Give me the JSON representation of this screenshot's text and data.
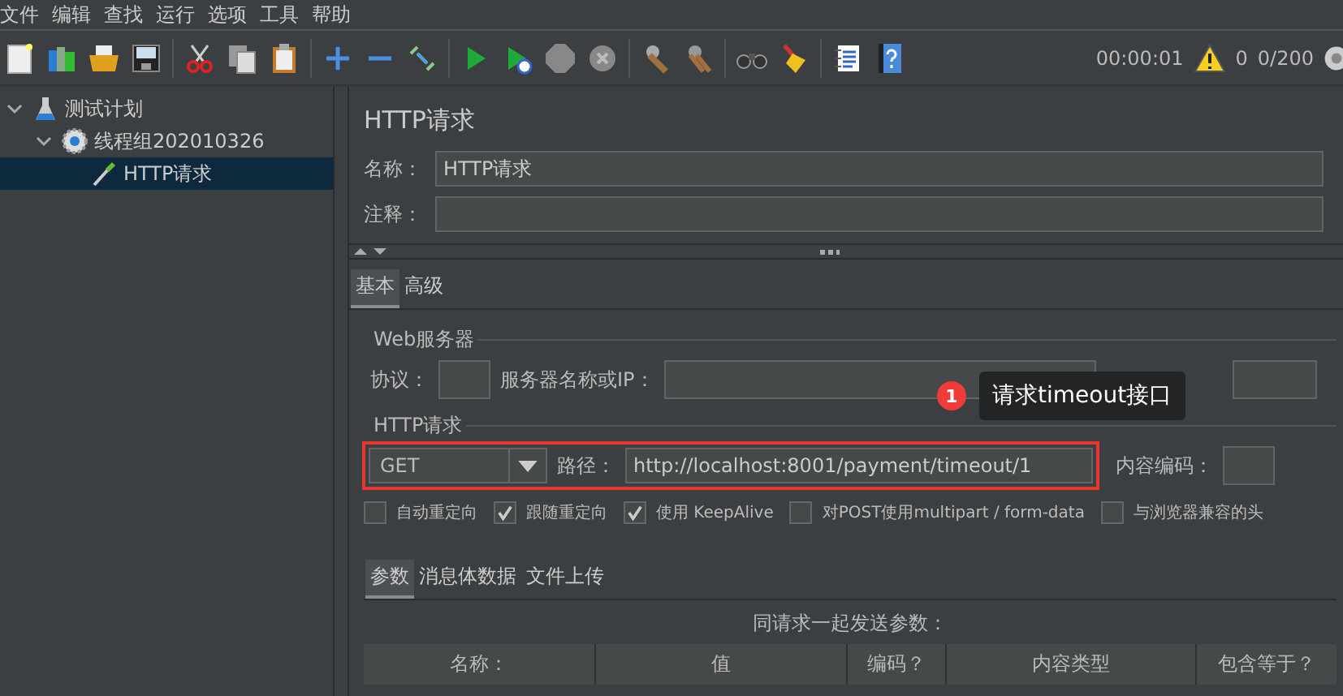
{
  "menu": [
    "文件",
    "编辑",
    "查找",
    "运行",
    "选项",
    "工具",
    "帮助"
  ],
  "toolbar": {
    "timer": "00:00:01",
    "warnings": "0",
    "threads": "0/200"
  },
  "tree": [
    {
      "label": "测试计划",
      "expanded": true,
      "selected": false,
      "children": [
        {
          "label": "线程组202010326",
          "expanded": true,
          "selected": false,
          "children": [
            {
              "label": "HTTP请求",
              "selected": true
            }
          ]
        }
      ]
    }
  ],
  "panel": {
    "title": "HTTP请求",
    "name_label": "名称：",
    "name_value": "HTTP请求",
    "comment_label": "注释：",
    "tabs": [
      {
        "label": "基本",
        "selected": true
      },
      {
        "label": "高级",
        "selected": false
      }
    ],
    "web_server": {
      "legend": "Web服务器",
      "protocol_label": "协议：",
      "server_label": "服务器名称或IP："
    },
    "http_request": {
      "legend": "HTTP请求",
      "method": "GET",
      "path_label": "路径：",
      "path": "http://localhost:8001/payment/timeout/1",
      "encoding_label": "内容编码："
    },
    "options": [
      {
        "label": "自动重定向",
        "checked": false
      },
      {
        "label": "跟随重定向",
        "checked": true
      },
      {
        "label": "使用 KeepAlive",
        "checked": true
      },
      {
        "label": "对POST使用multipart / form-data",
        "checked": false
      },
      {
        "label": "与浏览器兼容的头",
        "checked": false
      }
    ],
    "body_tabs": [
      {
        "label": "参数",
        "selected": true
      },
      {
        "label": "消息体数据",
        "selected": false
      },
      {
        "label": "文件上传",
        "selected": false
      }
    ],
    "params_title": "同请求一起发送参数：",
    "columns": [
      "名称：",
      "值",
      "编码？",
      "内容类型",
      "包含等于？"
    ]
  },
  "annotation": {
    "number": "1",
    "text": "请求timeout接口"
  }
}
